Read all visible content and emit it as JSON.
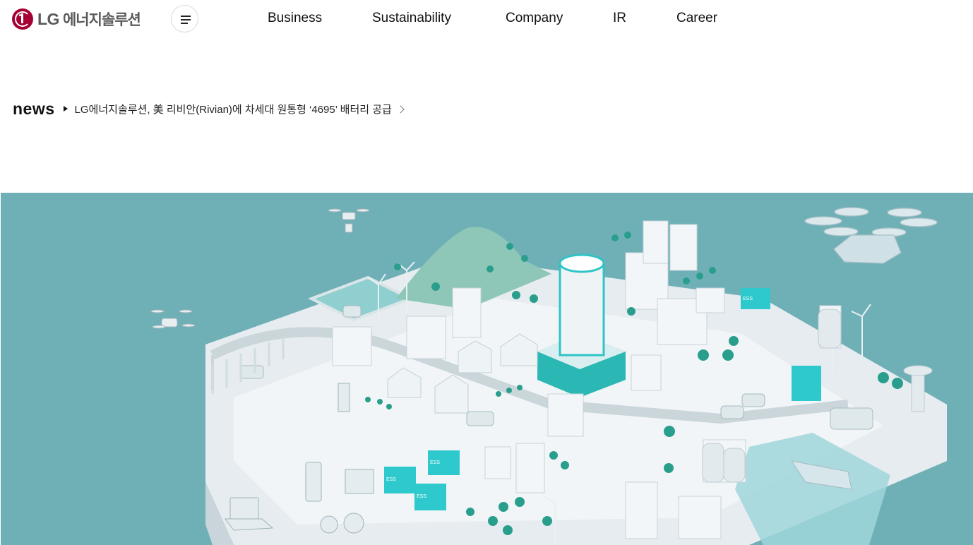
{
  "brand": {
    "logo_lg": "LG",
    "logo_name": "에너지솔루션"
  },
  "nav": {
    "items": [
      {
        "label": "Business"
      },
      {
        "label": "Sustainability"
      },
      {
        "label": "Company"
      },
      {
        "label": "IR"
      },
      {
        "label": "Career"
      }
    ]
  },
  "news": {
    "label": "news",
    "headline": "LG에너지솔루션, 美 리비안(Rivian)에 차세대 원통형 ‘4695’ 배터리 공급"
  },
  "hero": {
    "labels": {
      "ess": "ESS"
    },
    "colors": {
      "background": "#6fb0b7",
      "accent": "#2fc3c6",
      "brand": "#a50034"
    }
  }
}
